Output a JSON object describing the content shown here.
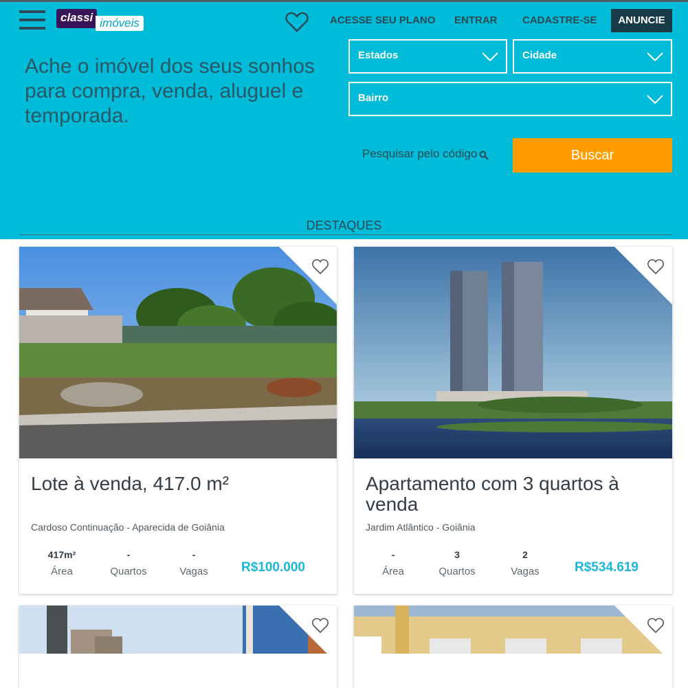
{
  "header": {
    "logo_part1": "classi",
    "logo_part2": "imóveis",
    "nav": [
      "ACESSE SEU PLANO",
      "ENTRAR",
      "CADASTRE-SE"
    ],
    "cta": "ANUNCIE"
  },
  "hero": {
    "headline": "Ache o imóvel dos seus sonhos para compra, venda, aluguel e temporada.",
    "filters": {
      "estados": "Estados",
      "cidade": "Cidade",
      "bairro": "Bairro"
    },
    "code_search": "Pesquisar pelo código",
    "search_button": "Buscar"
  },
  "section_title": "DESTAQUES",
  "listings": [
    {
      "title": "Lote à venda, 417.0 m²",
      "location": "Cardoso Continuação - Aparecida de Goiânia",
      "stats": [
        {
          "value": "417m²",
          "label": "Área"
        },
        {
          "value": "-",
          "label": "Quartos"
        },
        {
          "value": "-",
          "label": "Vagas"
        }
      ],
      "price": "R$100.000"
    },
    {
      "title": "Apartamento com 3 quartos à venda",
      "location": "Jardim Atlântico - Goiânia",
      "stats": [
        {
          "value": "-",
          "label": "Área"
        },
        {
          "value": "3",
          "label": "Quartos"
        },
        {
          "value": "2",
          "label": "Vagas"
        }
      ],
      "price": "R$534.619"
    }
  ],
  "colors": {
    "hero_bg": "#00bcd9",
    "dark_teal": "#173c47",
    "buscar_orange": "#ff9d00",
    "price_blue": "#19b8d8",
    "logo_purple": "#3a1458"
  }
}
